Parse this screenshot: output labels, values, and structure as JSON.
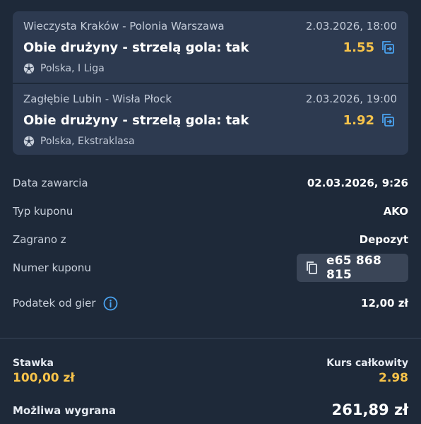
{
  "bets": [
    {
      "match": "Wieczysta Kraków - Polonia Warszawa",
      "datetime": "2.03.2026, 18:00",
      "market": "Obie drużyny - strzelą gola: tak",
      "odds": "1.55",
      "league": "Polska, I Liga"
    },
    {
      "match": "Zagłębie Lubin - Wisła Płock",
      "datetime": "2.03.2026, 19:00",
      "market": "Obie drużyny - strzelą gola: tak",
      "odds": "1.92",
      "league": "Polska, Ekstraklasa"
    }
  ],
  "details": {
    "date_label": "Data zawarcia",
    "date_value": "02.03.2026, 9:26",
    "type_label": "Typ kuponu",
    "type_value": "AKO",
    "source_label": "Zagrano z",
    "source_value": "Depozyt",
    "coupon_label": "Numer kuponu",
    "coupon_value": "e65 868 815",
    "tax_label": "Podatek od gier",
    "tax_value": "12,00 zł"
  },
  "summary": {
    "stake_label": "Stawka",
    "stake_value": "100,00 zł",
    "total_odds_label": "Kurs całkowity",
    "total_odds_value": "2.98",
    "win_label": "Możliwa wygrana",
    "win_value": "261,89 zł"
  },
  "icons": {
    "swap": "swap-arrows-icon",
    "sport": "football-icon",
    "copy": "copy-icon",
    "info": "info-icon"
  },
  "colors": {
    "background": "#1e2939",
    "card": "#2d3a50",
    "accent": "#f7c34a",
    "link": "#4aa3f0"
  }
}
